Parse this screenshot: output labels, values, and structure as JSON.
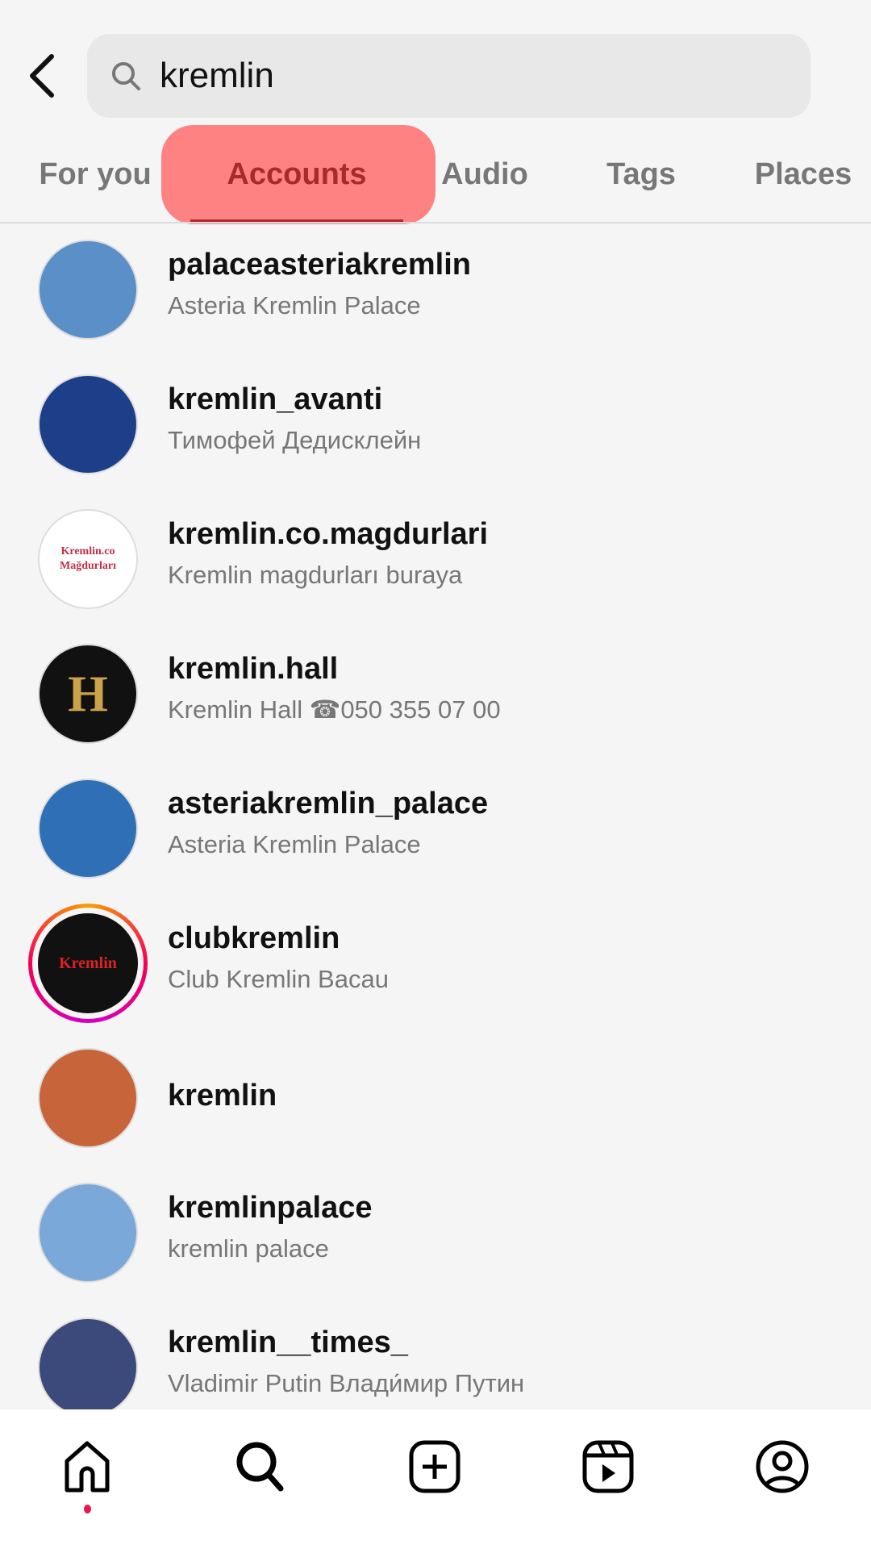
{
  "search": {
    "query": "kremlin"
  },
  "tabs": [
    {
      "label": "For you"
    },
    {
      "label": "Accounts",
      "active": true
    },
    {
      "label": "Audio"
    },
    {
      "label": "Tags"
    },
    {
      "label": "Places"
    }
  ],
  "accounts": [
    {
      "username": "palaceasteriakremlin",
      "name": "Asteria Kremlin Palace",
      "avatar": "#5a8fc8"
    },
    {
      "username": "kremlin_avanti",
      "name": "Тимофей Дедисклейн",
      "avatar": "#1d3f8a"
    },
    {
      "username": "kremlin.co.magdurlari",
      "name": "Kremlin magdurları buraya",
      "avatar": "#ffffff",
      "avatar_text": "Kremlin.co Mağdurları"
    },
    {
      "username": "kremlin.hall",
      "name": "Kremlin Hall  ☎050 355 07 00",
      "avatar": "#111111",
      "avatar_text": "H"
    },
    {
      "username": "asteriakremlin_palace",
      "name": "Asteria Kremlin Palace",
      "avatar": "#2e6fb5"
    },
    {
      "username": "clubkremlin",
      "name": "Club Kremlin Bacau",
      "avatar": "#111111",
      "avatar_text": "Kremlin",
      "story": true
    },
    {
      "username": "kremlin",
      "name": "",
      "avatar": "#c8643a"
    },
    {
      "username": "kremlinpalace",
      "name": "kremlin palace",
      "avatar": "#7aa8d8"
    },
    {
      "username": "kremlin__times_",
      "name": "Vladimir Putin Влади́мир Путин",
      "avatar": "#3b4a7a"
    }
  ],
  "nav": [
    {
      "icon": "home-icon",
      "active": true
    },
    {
      "icon": "search-icon"
    },
    {
      "icon": "create-icon"
    },
    {
      "icon": "reels-icon"
    },
    {
      "icon": "profile-icon"
    }
  ],
  "colors": {
    "highlight": "#ff7777",
    "notification_dot": "#f0134d"
  }
}
